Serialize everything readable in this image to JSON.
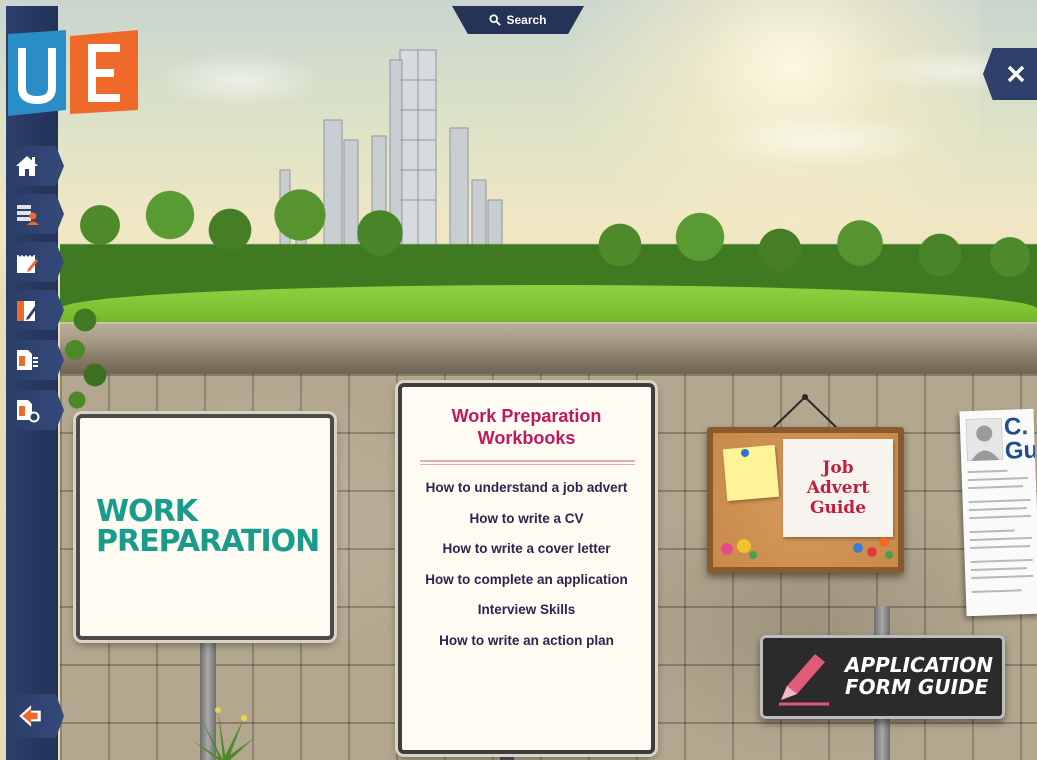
{
  "search": {
    "label": "Search"
  },
  "sidebar": {
    "logo_letters": "UE",
    "items": [
      {
        "name": "home"
      },
      {
        "name": "profile"
      },
      {
        "name": "notebook"
      },
      {
        "name": "edit"
      },
      {
        "name": "documents"
      },
      {
        "name": "settings-document"
      }
    ]
  },
  "work_preparation": {
    "line1": "WORK",
    "line2": "PREPARATION"
  },
  "workbooks": {
    "title_line1": "Work Preparation",
    "title_line2": "Workbooks",
    "links": [
      "How to understand a job advert",
      "How to write a CV",
      "How to write a cover letter",
      "How to complete an application",
      "Interview Skills",
      "How to write an action plan"
    ]
  },
  "job_advert_guide": {
    "line1": "Job",
    "line2": "Advert",
    "line3": "Guide"
  },
  "cv_guide": {
    "title": "C.\nGu"
  },
  "application_form_guide": {
    "line1": "APPLICATION",
    "line2": "FORM GUIDE"
  },
  "colors": {
    "nav": "#2d3f6b",
    "accent_pink": "#c2185b",
    "teal": "#1a9c8c",
    "link_text": "#2d2550",
    "jag_red": "#c21e3b"
  },
  "icons": [
    "search-icon",
    "close-icon",
    "home-icon",
    "profile-icon",
    "notebook-icon",
    "edit-icon",
    "documents-icon",
    "settings-document-icon",
    "back-arrow-icon",
    "pencil-icon",
    "avatar-icon"
  ]
}
